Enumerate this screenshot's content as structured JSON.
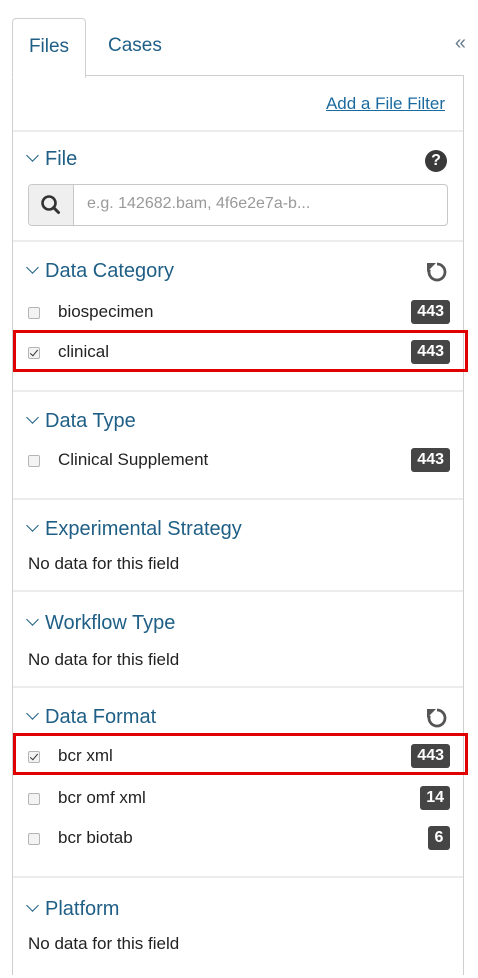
{
  "tabs": {
    "files": "Files",
    "cases": "Cases",
    "collapse": "«"
  },
  "panel": {
    "add_filter": "Add a File Filter"
  },
  "file": {
    "title": "File",
    "help": "?",
    "placeholder": "e.g. 142682.bam, 4f6e2e7a-b..."
  },
  "data_category": {
    "title": "Data Category",
    "items": [
      {
        "label": "biospecimen",
        "count": "443",
        "checked": false
      },
      {
        "label": "clinical",
        "count": "443",
        "checked": true
      }
    ]
  },
  "data_type": {
    "title": "Data Type",
    "items": [
      {
        "label": "Clinical Supplement",
        "count": "443",
        "checked": false
      }
    ]
  },
  "experimental_strategy": {
    "title": "Experimental Strategy",
    "empty": "No data for this field"
  },
  "workflow_type": {
    "title": "Workflow Type",
    "empty": "No data for this field"
  },
  "data_format": {
    "title": "Data Format",
    "items": [
      {
        "label": "bcr xml",
        "count": "443",
        "checked": true
      },
      {
        "label": "bcr omf xml",
        "count": "14",
        "checked": false
      },
      {
        "label": "bcr biotab",
        "count": "6",
        "checked": false
      }
    ]
  },
  "platform": {
    "title": "Platform",
    "empty": "No data for this field"
  },
  "colors": {
    "link": "#1f5f86",
    "badge": "#454545",
    "highlight": "#e00000"
  }
}
